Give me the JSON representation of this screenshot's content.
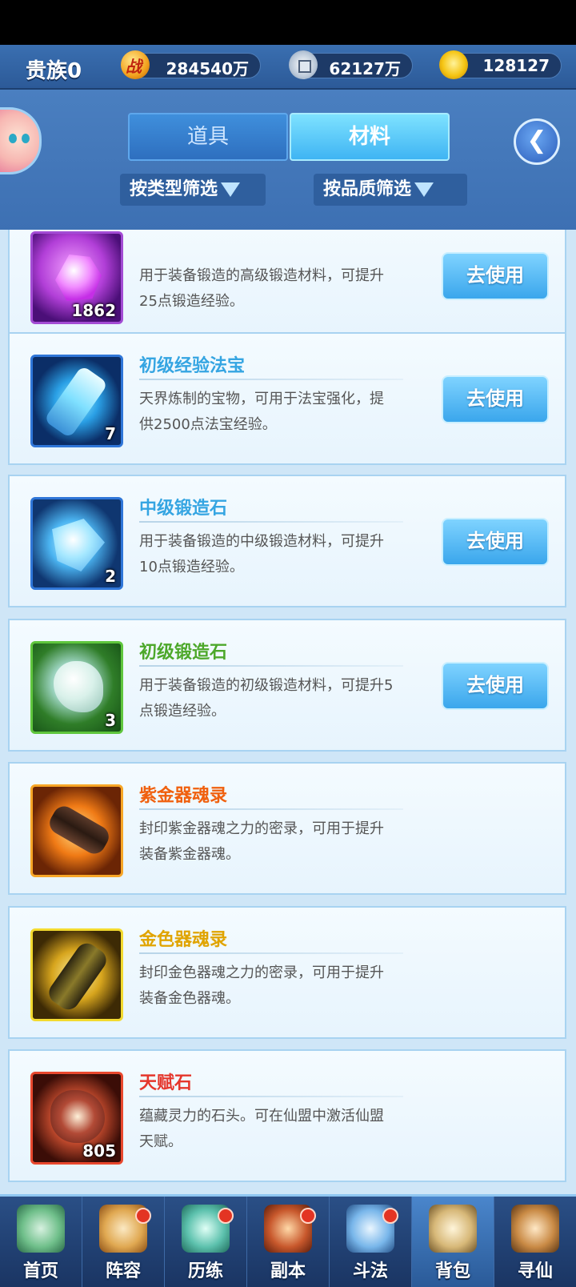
{
  "topbar": {
    "rank": "贵族0",
    "power_icon_char": "战",
    "power": "284540万",
    "coins": "62127万",
    "gold": "128127"
  },
  "tabs": [
    {
      "label": "道具",
      "active": false
    },
    {
      "label": "材料",
      "active": true
    }
  ],
  "filters": {
    "by_type": "按类型筛选",
    "by_quality": "按品质筛选"
  },
  "use_button_label": "去使用",
  "items": [
    {
      "name": "",
      "name_color": "#9b2fc4",
      "desc_line1": "用于装备锻造的高级锻造材料，可提升",
      "desc_line2": "25点锻造经验。",
      "count": "1862",
      "has_button": true,
      "icon": "purple-gem-icon"
    },
    {
      "name": "初级经验法宝",
      "name_color": "#35a5e2",
      "desc_line1": "天界炼制的宝物，可用于法宝强化，提",
      "desc_line2": "供2500点法宝经验。",
      "count": "7",
      "has_button": true,
      "icon": "blue-bottle-icon"
    },
    {
      "name": "中级锻造石",
      "name_color": "#35a5e2",
      "desc_line1": "用于装备锻造的中级锻造材料，可提升",
      "desc_line2": "10点锻造经验。",
      "count": "2",
      "has_button": true,
      "icon": "blue-gem-icon"
    },
    {
      "name": "初级锻造石",
      "name_color": "#4da82a",
      "desc_line1": "用于装备锻造的初级锻造材料，可提升5",
      "desc_line2": "点锻造经验。",
      "count": "3",
      "has_button": true,
      "icon": "green-stone-icon"
    },
    {
      "name": "紫金器魂录",
      "name_color": "#f0600e",
      "desc_line1": "封印紫金器魂之力的密录，可用于提升",
      "desc_line2": "装备紫金器魂。",
      "count": "",
      "has_button": false,
      "icon": "orange-scroll-icon"
    },
    {
      "name": "金色器魂录",
      "name_color": "#e0a400",
      "desc_line1": "封印金色器魂之力的密录，可用于提升",
      "desc_line2": "装备金色器魂。",
      "count": "",
      "has_button": false,
      "icon": "gold-scroll-icon"
    },
    {
      "name": "天赋石",
      "name_color": "#e5372c",
      "desc_line1": "蕴藏灵力的石头。可在仙盟中激活仙盟",
      "desc_line2": "天赋。",
      "count": "805",
      "has_button": false,
      "icon": "talent-stone-icon"
    }
  ],
  "nav": [
    {
      "label": "首页",
      "dot": false,
      "active": false,
      "color": "#7cc6a2"
    },
    {
      "label": "阵容",
      "dot": true,
      "active": false,
      "color": "#e3b56b"
    },
    {
      "label": "历练",
      "dot": true,
      "active": false,
      "color": "#6fc9b8"
    },
    {
      "label": "副本",
      "dot": true,
      "active": false,
      "color": "#c9653a"
    },
    {
      "label": "斗法",
      "dot": true,
      "active": false,
      "color": "#7fb8e8"
    },
    {
      "label": "背包",
      "dot": false,
      "active": true,
      "color": "#d8c18a"
    },
    {
      "label": "寻仙",
      "dot": false,
      "active": false,
      "color": "#c98f4a"
    }
  ]
}
